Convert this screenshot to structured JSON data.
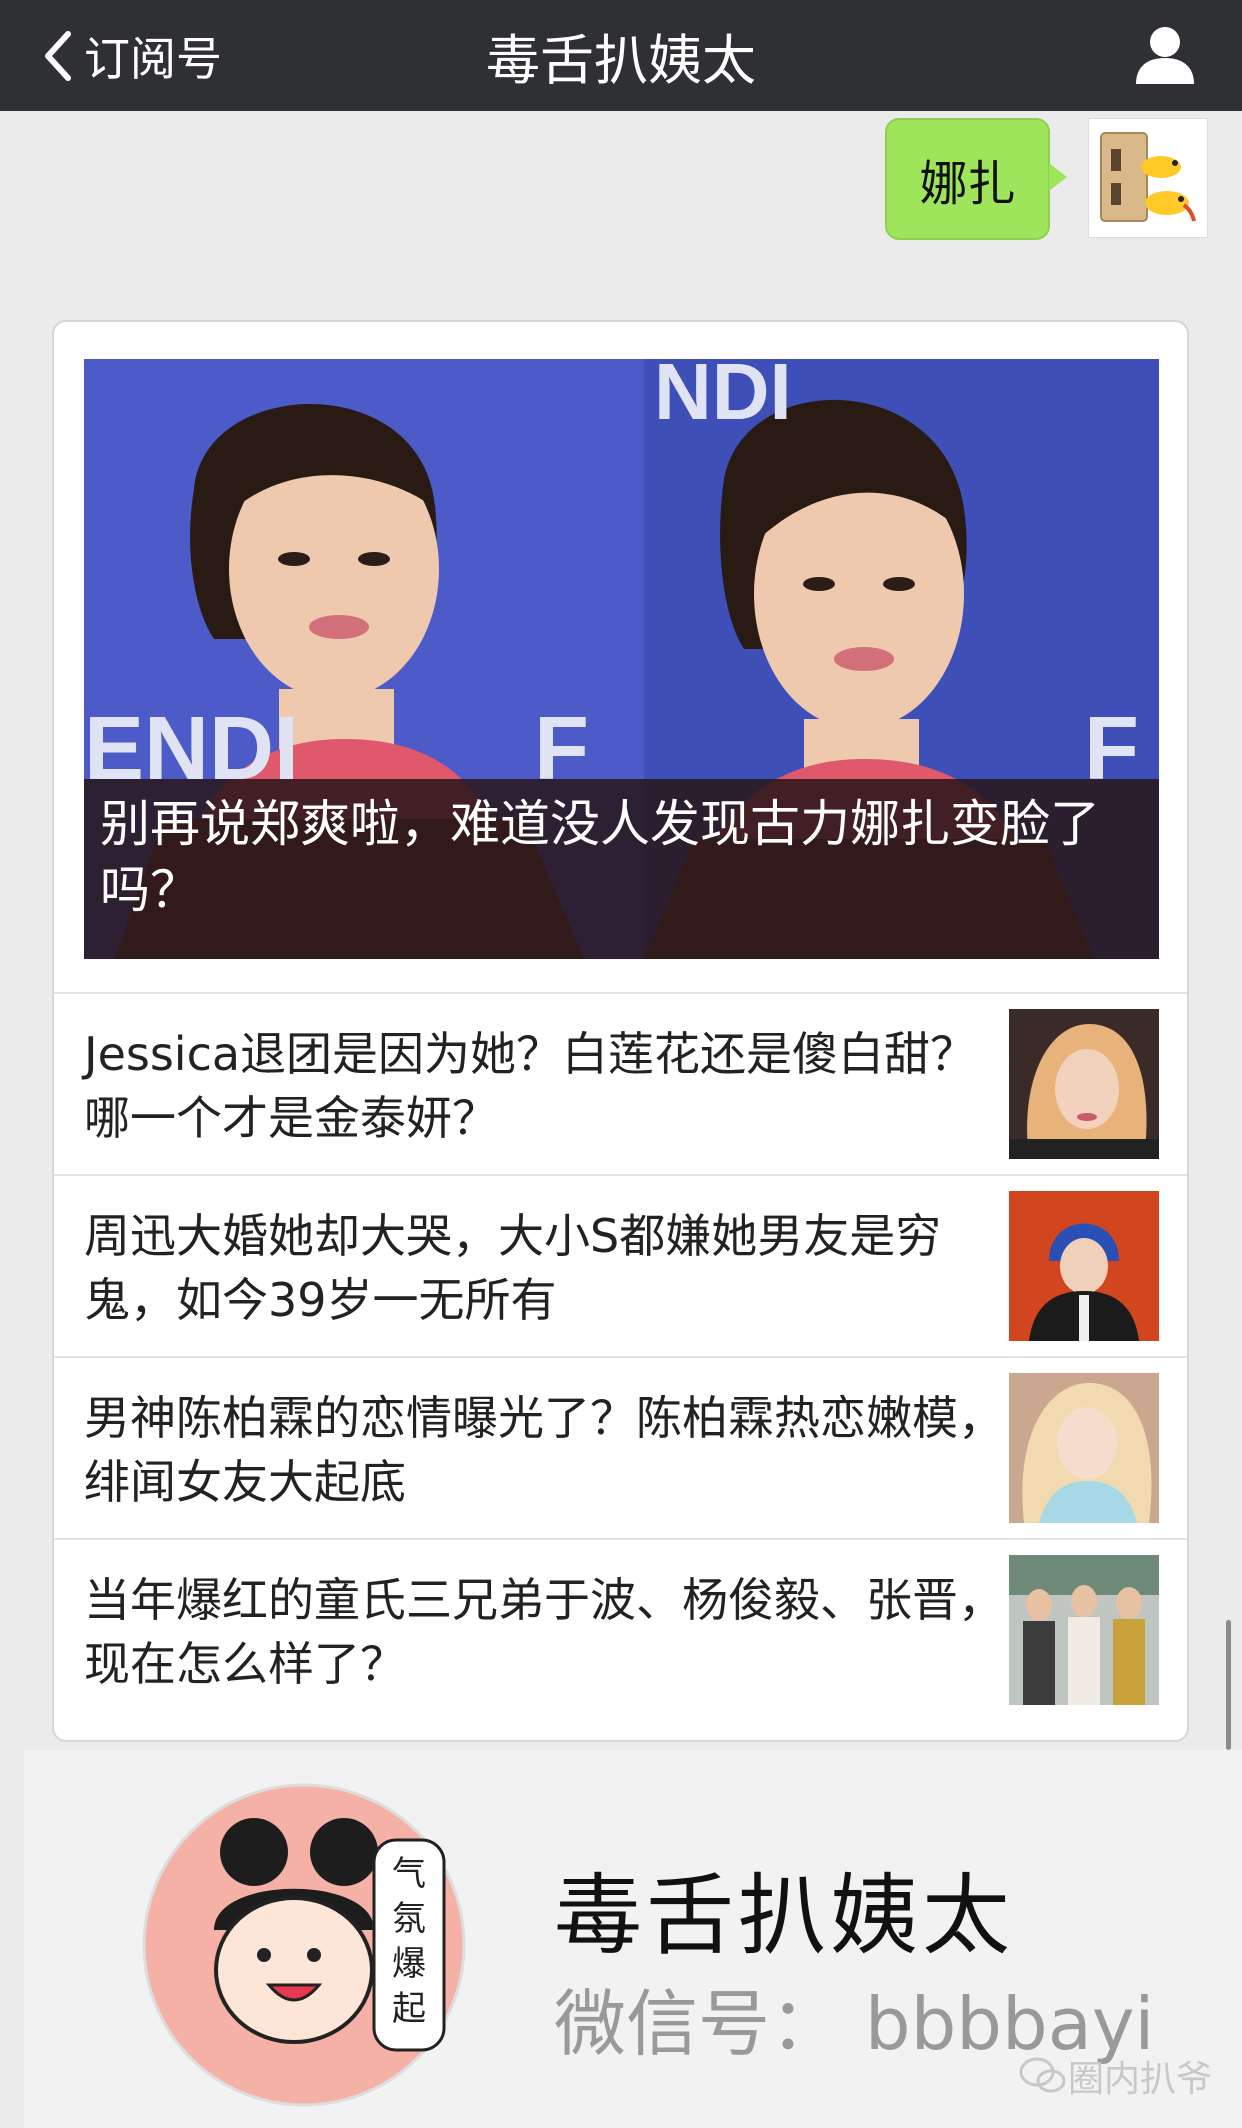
{
  "nav": {
    "back_label": "订阅号",
    "title": "毒舌扒姨太"
  },
  "chat": {
    "message": "娜扎"
  },
  "article": {
    "cover_title": "别再说郑爽啦，难道没人发现古力娜扎变脸了吗？",
    "items": [
      {
        "title": "Jessica退团是因为她？白莲花还是傻白甜？哪一个才是金泰妍？"
      },
      {
        "title": "周迅大婚她却大哭，大小S都嫌她男友是穷鬼，如今39岁一无所有"
      },
      {
        "title": "男神陈柏霖的恋情曝光了？陈柏霖热恋嫩模，绯闻女友大起底"
      },
      {
        "title": "当年爆红的童氏三兄弟于波、杨俊毅、张晋，现在怎么样了？"
      }
    ]
  },
  "profile": {
    "name": "毒舌扒姨太",
    "wechat_id": "微信号： bbbbayi",
    "watermark": "圈内扒爷",
    "avatar_text": "气氛爆起来"
  },
  "colors": {
    "nav_bg": "#2e3033",
    "bubble": "#9fe55b",
    "page_bg": "#ebebeb"
  }
}
